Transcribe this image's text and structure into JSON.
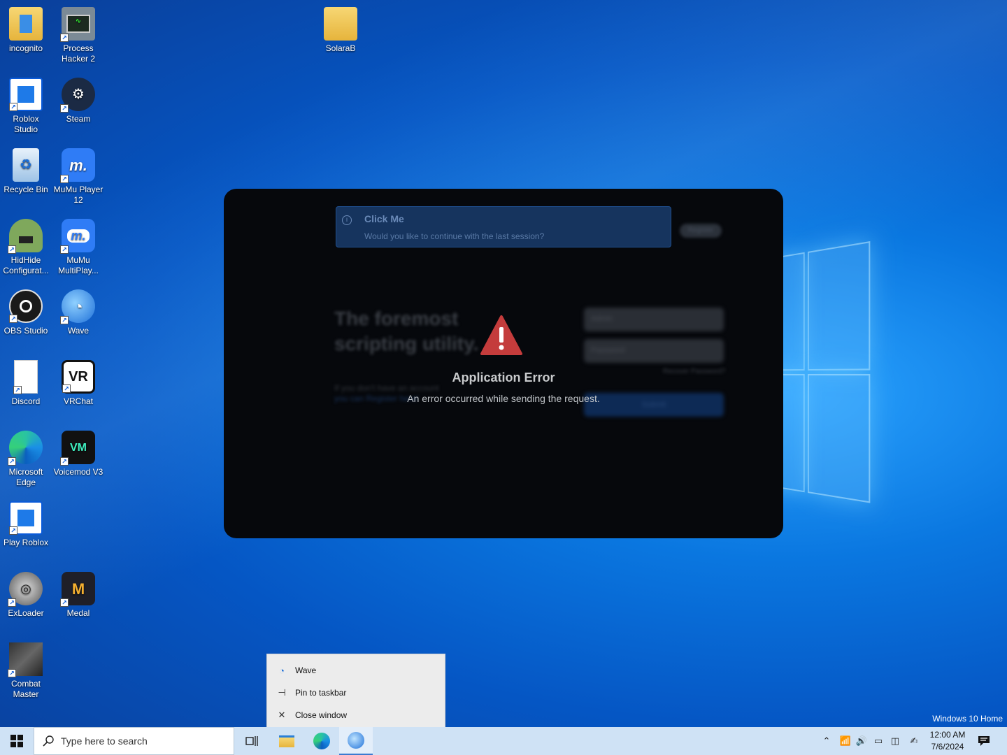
{
  "desktop": {
    "icons": [
      {
        "label": "incognito",
        "icon": "folder-icon"
      },
      {
        "label": "Process Hacker 2",
        "icon": "process-hacker-icon"
      },
      {
        "label": "SolaraB",
        "icon": "folder-icon"
      },
      {
        "label": "Roblox Studio",
        "icon": "roblox-studio-icon"
      },
      {
        "label": "Steam",
        "icon": "steam-icon"
      },
      {
        "label": "Recycle Bin",
        "icon": "recycle-bin-icon"
      },
      {
        "label": "MuMu Player 12",
        "icon": "mumu-player-icon"
      },
      {
        "label": "HidHide Configurat...",
        "icon": "hidhide-icon"
      },
      {
        "label": "MuMu MultiPlay...",
        "icon": "mumu-multiplayer-icon"
      },
      {
        "label": "OBS Studio",
        "icon": "obs-icon"
      },
      {
        "label": "Wave",
        "icon": "wave-icon"
      },
      {
        "label": "Discord",
        "icon": "blank-file-icon"
      },
      {
        "label": "VRChat",
        "icon": "vrchat-icon"
      },
      {
        "label": "Microsoft Edge",
        "icon": "edge-icon"
      },
      {
        "label": "Voicemod V3",
        "icon": "voicemod-icon"
      },
      {
        "label": "Play Roblox",
        "icon": "roblox-icon"
      },
      {
        "label": "ExLoader",
        "icon": "exloader-icon"
      },
      {
        "label": "Medal",
        "icon": "medal-icon"
      },
      {
        "label": "Combat Master",
        "icon": "combat-master-icon"
      }
    ],
    "watermark": "Windows 10 Home"
  },
  "app": {
    "toast_title": "Click Me",
    "toast_message": "Would you like to continue with the last session?",
    "register_label": "Register",
    "headline": "The foremost scripting utility.",
    "subline_1": "If you don't have an account",
    "subline_2": "you can Register here!",
    "username_placeholder": "Admin",
    "password_placeholder": "Password",
    "forgot_label": "Recover Password?",
    "submit_label": "Submit",
    "error_title": "Application Error",
    "error_message": "An error occurred while sending the request.",
    "colors": {
      "warning": "#c43c3c",
      "background": "#06080c"
    }
  },
  "jumplist": {
    "items": [
      {
        "label": "Wave",
        "icon": "wave-icon"
      },
      {
        "label": "Pin to taskbar",
        "icon": "pin-icon"
      },
      {
        "label": "Close window",
        "icon": "close-icon"
      }
    ]
  },
  "taskbar": {
    "search_placeholder": "Type here to search",
    "time": "12:00 AM",
    "date": "7/6/2024"
  }
}
